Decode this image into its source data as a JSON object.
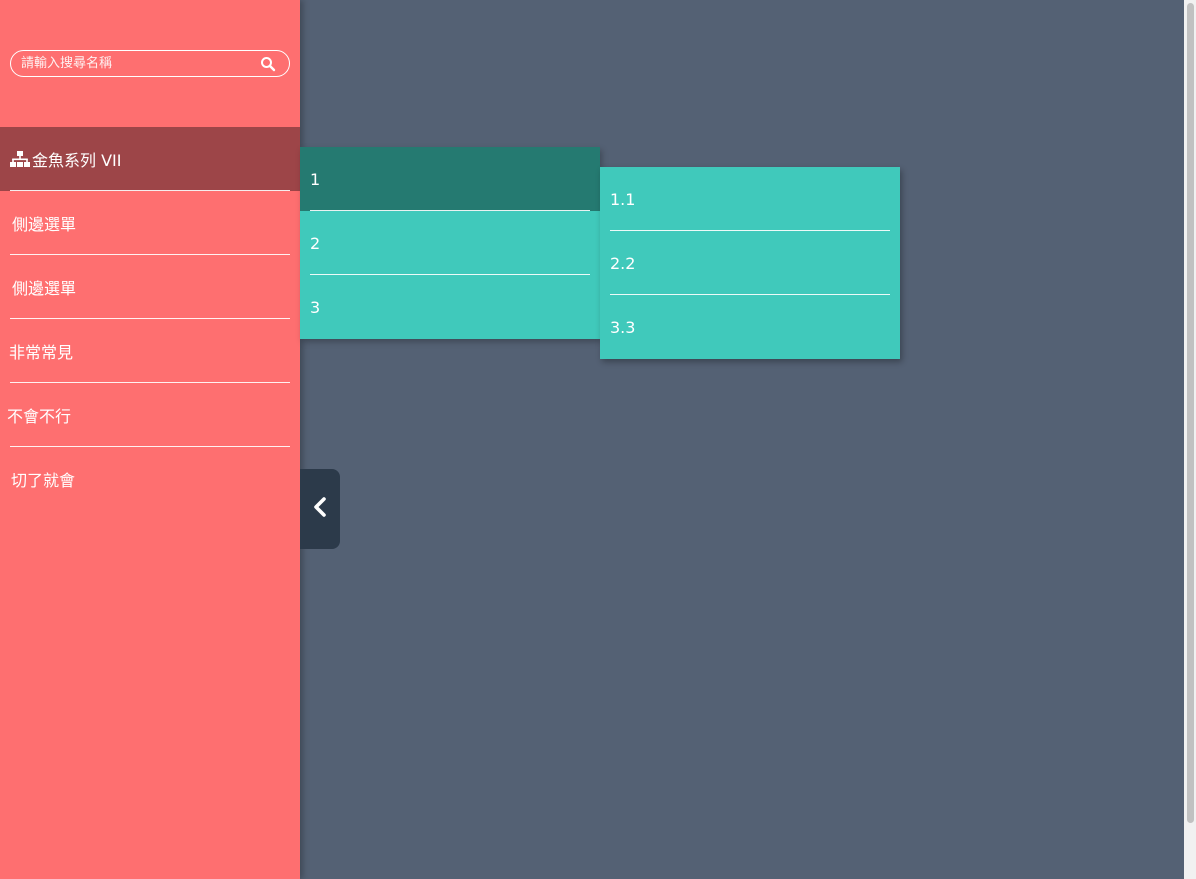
{
  "colors": {
    "background": "#546174",
    "sidebar": "#fe6f70",
    "sidebar_active": "#9d4548",
    "submenu": "#40c9bb",
    "submenu_active": "#257a71",
    "toggle": "#2c3a4a"
  },
  "search": {
    "placeholder": "請輸入搜尋名稱",
    "icon": "search-icon"
  },
  "sidebar": {
    "items": [
      {
        "label": "金魚系列 VII",
        "icon": "sitemap-icon",
        "active": true
      },
      {
        "label": "側邊選單"
      },
      {
        "label": "側邊選單"
      },
      {
        "label": "非常常見"
      },
      {
        "label": "不會不行"
      },
      {
        "label": "切了就會"
      }
    ]
  },
  "submenu_level1": {
    "items": [
      {
        "label": "1",
        "active": true
      },
      {
        "label": "2"
      },
      {
        "label": "3"
      }
    ]
  },
  "submenu_level2": {
    "items": [
      {
        "label": "1.1"
      },
      {
        "label": "2.2"
      },
      {
        "label": "3.3"
      }
    ]
  },
  "toggle": {
    "icon": "chevron-left-icon"
  }
}
